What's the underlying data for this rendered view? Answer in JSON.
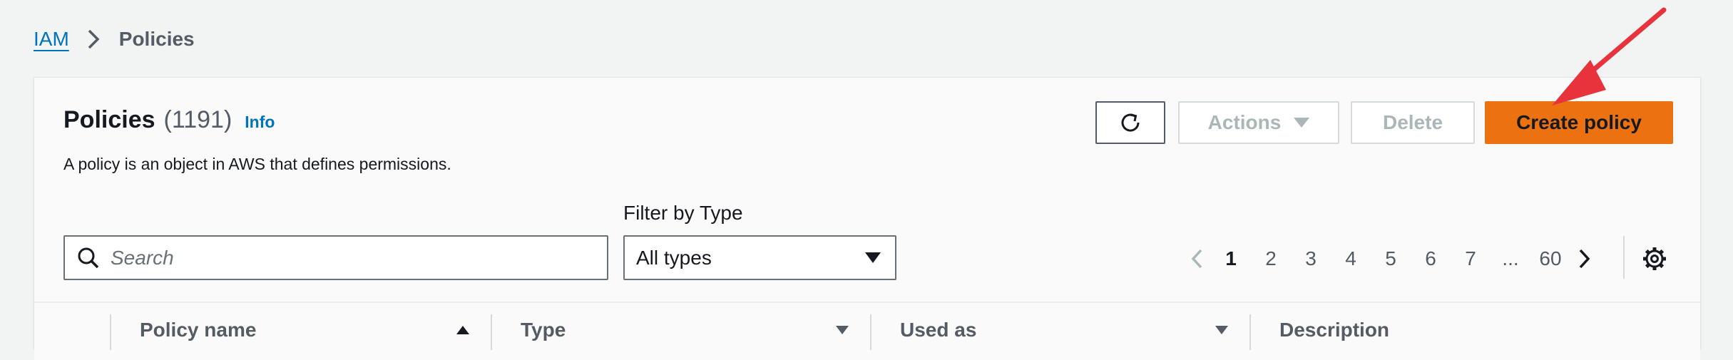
{
  "breadcrumb": {
    "root": "IAM",
    "current": "Policies"
  },
  "header": {
    "title": "Policies",
    "count": "(1191)",
    "info": "Info",
    "description": "A policy is an object in AWS that defines permissions."
  },
  "toolbar": {
    "refresh_icon": "refresh-icon",
    "actions_label": "Actions",
    "delete_label": "Delete",
    "create_label": "Create policy"
  },
  "filters": {
    "search_placeholder": "Search",
    "type_label": "Filter by Type",
    "type_selected": "All types"
  },
  "pagination": {
    "pages": [
      "1",
      "2",
      "3",
      "4",
      "5",
      "6",
      "7",
      "...",
      "60"
    ],
    "current": "1"
  },
  "table": {
    "columns": [
      "Policy name",
      "Type",
      "Used as",
      "Description"
    ]
  },
  "colors": {
    "accent": "#ec7211",
    "link": "#0073bb",
    "annotation_arrow": "#e8333c"
  }
}
